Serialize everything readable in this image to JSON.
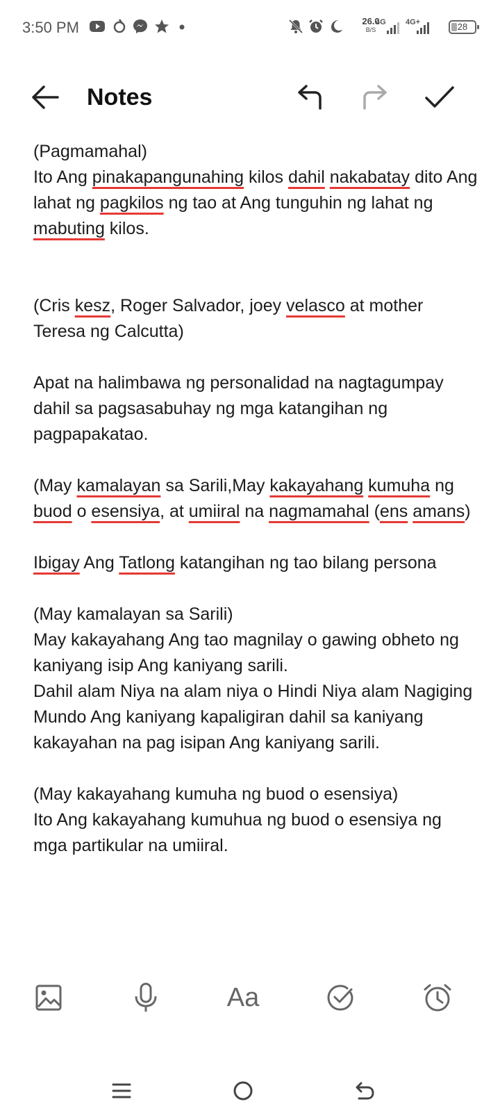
{
  "status_bar": {
    "time": "3:50 PM",
    "net_speed": "26.0",
    "net_speed_unit": "B/S",
    "net_label_1": "4G",
    "net_label_2": "4G+",
    "battery": "28",
    "icons": [
      "youtube-icon",
      "app-icon",
      "messenger-icon",
      "star-icon",
      "dot-icon",
      "mute-icon",
      "alarm-icon",
      "moon-icon",
      "signal-icon",
      "signal-icon",
      "battery-icon"
    ]
  },
  "toolbar": {
    "title": "Notes",
    "icons": [
      "back-arrow-icon",
      "undo-icon",
      "redo-icon",
      "check-icon"
    ]
  },
  "note": {
    "p1_line1": "(Pagmamahal)",
    "p1_words": [
      "Ito Ang ",
      "pinakapangunahing",
      " kilos ",
      "dahil",
      " ",
      "nakabatay",
      " dito Ang lahat ng ",
      "pagkilos",
      " ng tao at Ang tunguhin ng lahat ng ",
      "mabuting",
      " kilos."
    ],
    "p2_words": [
      "(Cris ",
      "kesz",
      ", Roger Salvador, joey ",
      "velasco",
      " at mother Teresa ng Calcutta)"
    ],
    "p3": "Apat na halimbawa ng personalidad na nagtagumpay dahil sa pagsasabuhay ng mga katangihan ng pagpapakatao.",
    "p4_words": [
      "(May ",
      "kamalayan",
      " sa Sarili,May ",
      "kakayahang",
      " ",
      "kumuha",
      " ng ",
      "buod",
      " o ",
      "esensiya",
      ", at ",
      "umiiral",
      " na ",
      "nagmamahal",
      " (",
      "ens",
      " ",
      "amans",
      ")"
    ],
    "p5_words": [
      "Ibigay",
      " Ang ",
      "Tatlong",
      " katangihan ng tao bilang persona"
    ],
    "p6_heading": "(May kamalayan sa Sarili)",
    "p6_body1": "May kakayahang Ang tao magnilay o gawing obheto ng kaniyang isip Ang kaniyang sarili.",
    "p6_body2": "Dahil alam Niya na alam niya o Hindi Niya alam Nagiging Mundo Ang kaniyang kapaligiran dahil sa kaniyang kakayahan na pag isipan Ang kaniyang sarili.",
    "p7_heading": "(May kakayahang kumuha ng buod o esensiya)",
    "p7_body": "Ito Ang kakayahang kumuhua ng buod o esensiya ng mga partikular na umiiral."
  },
  "bottom_tools": {
    "aa_label": "Aa",
    "icons": [
      "image-icon",
      "microphone-icon",
      "text-format-icon",
      "checklist-icon",
      "alarm-reminder-icon"
    ]
  },
  "nav_bar": {
    "icons": [
      "menu-icon",
      "home-icon",
      "back-icon"
    ]
  },
  "colors": {
    "spellcheck_underline": "#e53935",
    "text": "#1c1c1c",
    "icon_gray": "#666666"
  }
}
